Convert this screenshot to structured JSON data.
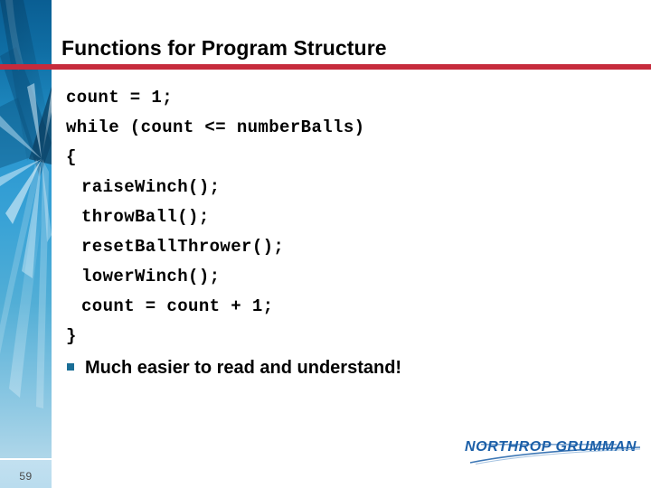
{
  "slide": {
    "title": "Functions for Program Structure",
    "page_number": "59",
    "accent_rule_color": "#c62b3c",
    "sidebar_color_top": "#0a5e93",
    "sidebar_color_bottom": "#bfdeee",
    "bullet_marker_color": "#1a6e96"
  },
  "code": {
    "lines": [
      {
        "text": "count = 1;",
        "indent": false
      },
      {
        "text": "while (count <= numberBalls)",
        "indent": false
      },
      {
        "text": "{",
        "indent": false
      },
      {
        "text": "raiseWinch();",
        "indent": true
      },
      {
        "text": "throwBall();",
        "indent": true
      },
      {
        "text": "resetBallThrower();",
        "indent": true
      },
      {
        "text": "lowerWinch();",
        "indent": true
      },
      {
        "text": "count = count + 1;",
        "indent": true
      },
      {
        "text": "}",
        "indent": false
      }
    ]
  },
  "bullet": {
    "marker": "square-bullet-icon",
    "text": "Much easier to read and understand!"
  },
  "logo": {
    "name": "northrop-grumman-logo",
    "text": "NORTHROP GRUMMAN",
    "color": "#1b5fa8"
  }
}
